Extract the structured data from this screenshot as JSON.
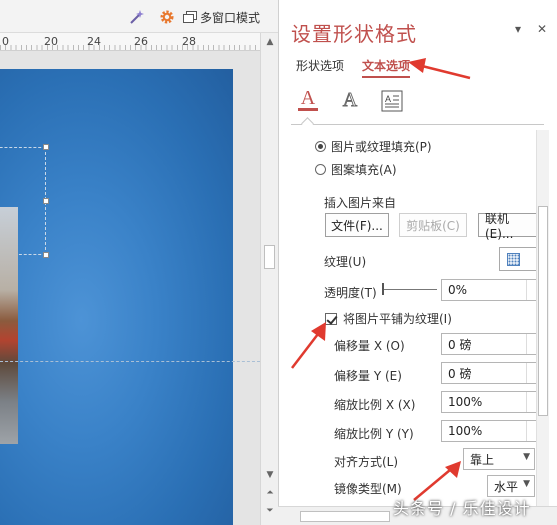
{
  "toolbar": {
    "multi_window_label": "多窗口模式",
    "icons": [
      "magic-wand-icon",
      "gear-icon",
      "windows-icon"
    ]
  },
  "ruler": {
    "labels": [
      "0",
      "20",
      "24",
      "26",
      "28"
    ]
  },
  "pane": {
    "title": "设置形状格式",
    "dropdown_glyph": "▾",
    "close_glyph": "✕",
    "tabs": [
      {
        "label": "形状选项",
        "active": false
      },
      {
        "label": "文本选项",
        "active": true
      }
    ],
    "icons": [
      "text-fill-icon",
      "text-effects-icon",
      "textbox-icon"
    ],
    "fill_options": [
      {
        "label": "图片或纹理填充(P)",
        "selected": true
      },
      {
        "label": "图案填充(A)",
        "selected": false
      }
    ],
    "insert_from_label": "插入图片来自",
    "buttons": {
      "file": "文件(F)...",
      "clipboard": "剪贴板(C)",
      "online": "联机(E)..."
    },
    "texture_label": "纹理(U)",
    "transparency_label": "透明度(T)",
    "transparency_value": "0%",
    "tile_checkbox": {
      "label": "将图片平铺为纹理(I)",
      "checked": true
    },
    "offset_x": {
      "label": "偏移量 X (O)",
      "value": "0 磅"
    },
    "offset_y": {
      "label": "偏移量 Y (E)",
      "value": "0 磅"
    },
    "scale_x": {
      "label": "缩放比例 X (X)",
      "value": "100%"
    },
    "scale_y": {
      "label": "缩放比例 Y (Y)",
      "value": "100%"
    },
    "align": {
      "label": "对齐方式(L)",
      "value": "靠上"
    },
    "mirror": {
      "label": "镜像类型(M)",
      "value": "水平"
    }
  },
  "watermark": "头条号 / 乐佳设计",
  "colors": {
    "accent": "#c0504d",
    "annotation_arrow": "#e03a2f",
    "slide_blue": "#3a82c8"
  }
}
